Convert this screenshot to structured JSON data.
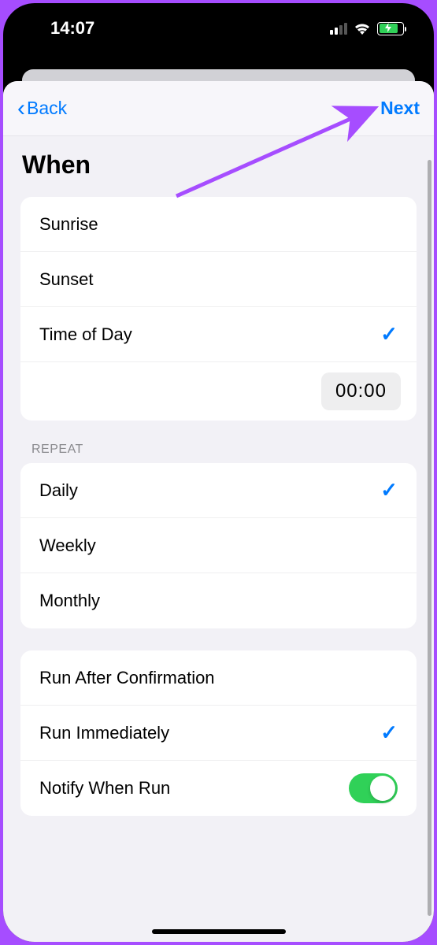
{
  "status": {
    "time": "14:07"
  },
  "nav": {
    "back_label": "Back",
    "next_label": "Next"
  },
  "page_title": "When",
  "when_options": {
    "sunrise": "Sunrise",
    "sunset": "Sunset",
    "time_of_day": "Time of Day",
    "time_value": "00:00"
  },
  "repeat_header": "REPEAT",
  "repeat_options": {
    "daily": "Daily",
    "weekly": "Weekly",
    "monthly": "Monthly"
  },
  "run_options": {
    "after_confirmation": "Run After Confirmation",
    "immediately": "Run Immediately",
    "notify": "Notify When Run"
  },
  "annotation": {
    "arrow_color": "#a64dff"
  }
}
